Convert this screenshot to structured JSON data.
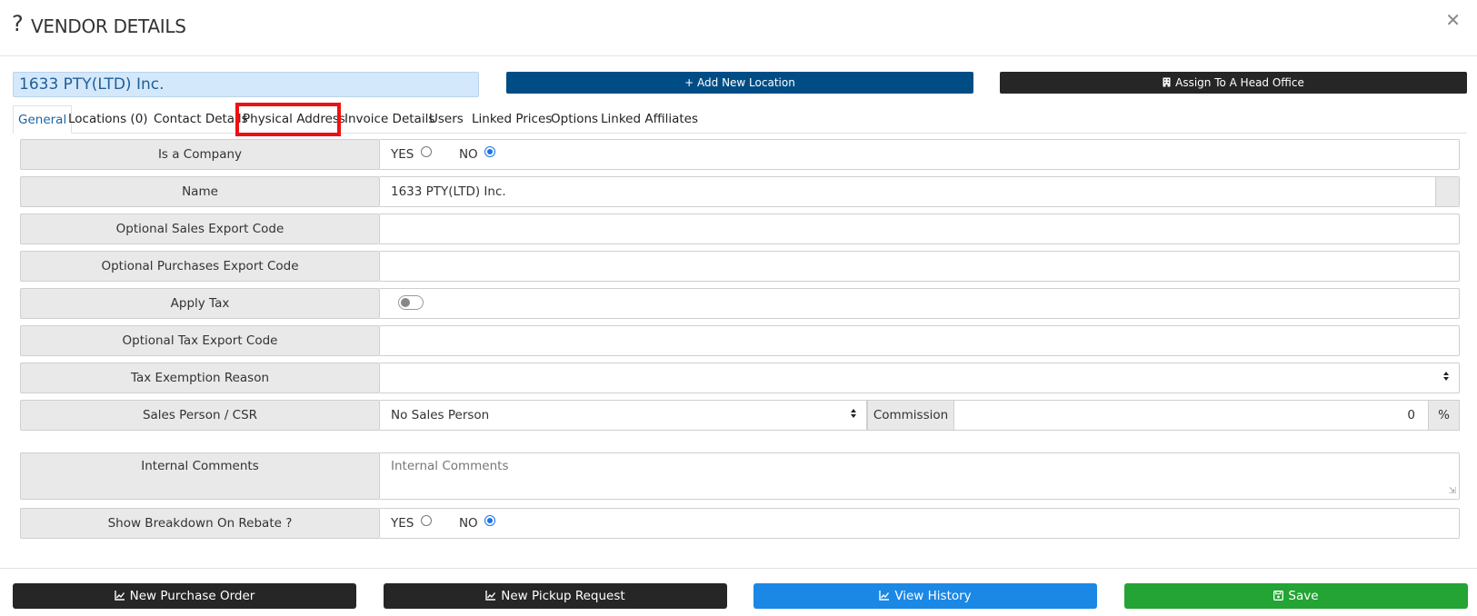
{
  "dialog": {
    "help_icon": "?",
    "title": "VENDOR DETAILS",
    "close_icon": "✕"
  },
  "vendor_name": "1633 PTY(LTD) Inc.",
  "top_buttons": {
    "add_location": "+ Add New Location",
    "assign_head_office": "Assign To A Head Office",
    "assign_icon": "building-icon"
  },
  "tabs": [
    {
      "label": "General",
      "active": true
    },
    {
      "label": "Locations (0)"
    },
    {
      "label": "Contact Details"
    },
    {
      "label": "Physical Address",
      "highlighted": true
    },
    {
      "label": "Invoice Details"
    },
    {
      "label": "Users"
    },
    {
      "label": "Linked Prices"
    },
    {
      "label": "Options"
    },
    {
      "label": "Linked Affiliates"
    }
  ],
  "form": {
    "is_company": {
      "label": "Is a Company",
      "yes": "YES",
      "no": "NO",
      "selected": "NO"
    },
    "name": {
      "label": "Name",
      "value": "1633 PTY(LTD) Inc."
    },
    "sales_export_code": {
      "label": "Optional Sales Export Code",
      "value": ""
    },
    "purchases_export_code": {
      "label": "Optional Purchases Export Code",
      "value": ""
    },
    "apply_tax": {
      "label": "Apply Tax",
      "enabled": false
    },
    "tax_export_code": {
      "label": "Optional Tax Export Code",
      "value": ""
    },
    "tax_exemption_reason": {
      "label": "Tax Exemption Reason",
      "value": ""
    },
    "sales_person": {
      "label": "Sales Person / CSR",
      "value": "No Sales Person",
      "commission_label": "Commission",
      "commission_value": "0",
      "unit": "%"
    },
    "internal_comments": {
      "label": "Internal Comments",
      "placeholder": "Internal Comments"
    },
    "show_breakdown": {
      "label": "Show Breakdown On Rebate ?",
      "yes": "YES",
      "no": "NO",
      "selected": "NO"
    }
  },
  "footer_buttons": {
    "new_purchase_order": "New Purchase Order",
    "new_pickup_request": "New Pickup Request",
    "view_history": "View History",
    "save": "Save"
  },
  "colors": {
    "primary_dark_blue": "#004d85",
    "dark": "#262626",
    "history_blue": "#1b88e5",
    "save_green": "#23a434",
    "highlight_red": "#ee1111"
  }
}
